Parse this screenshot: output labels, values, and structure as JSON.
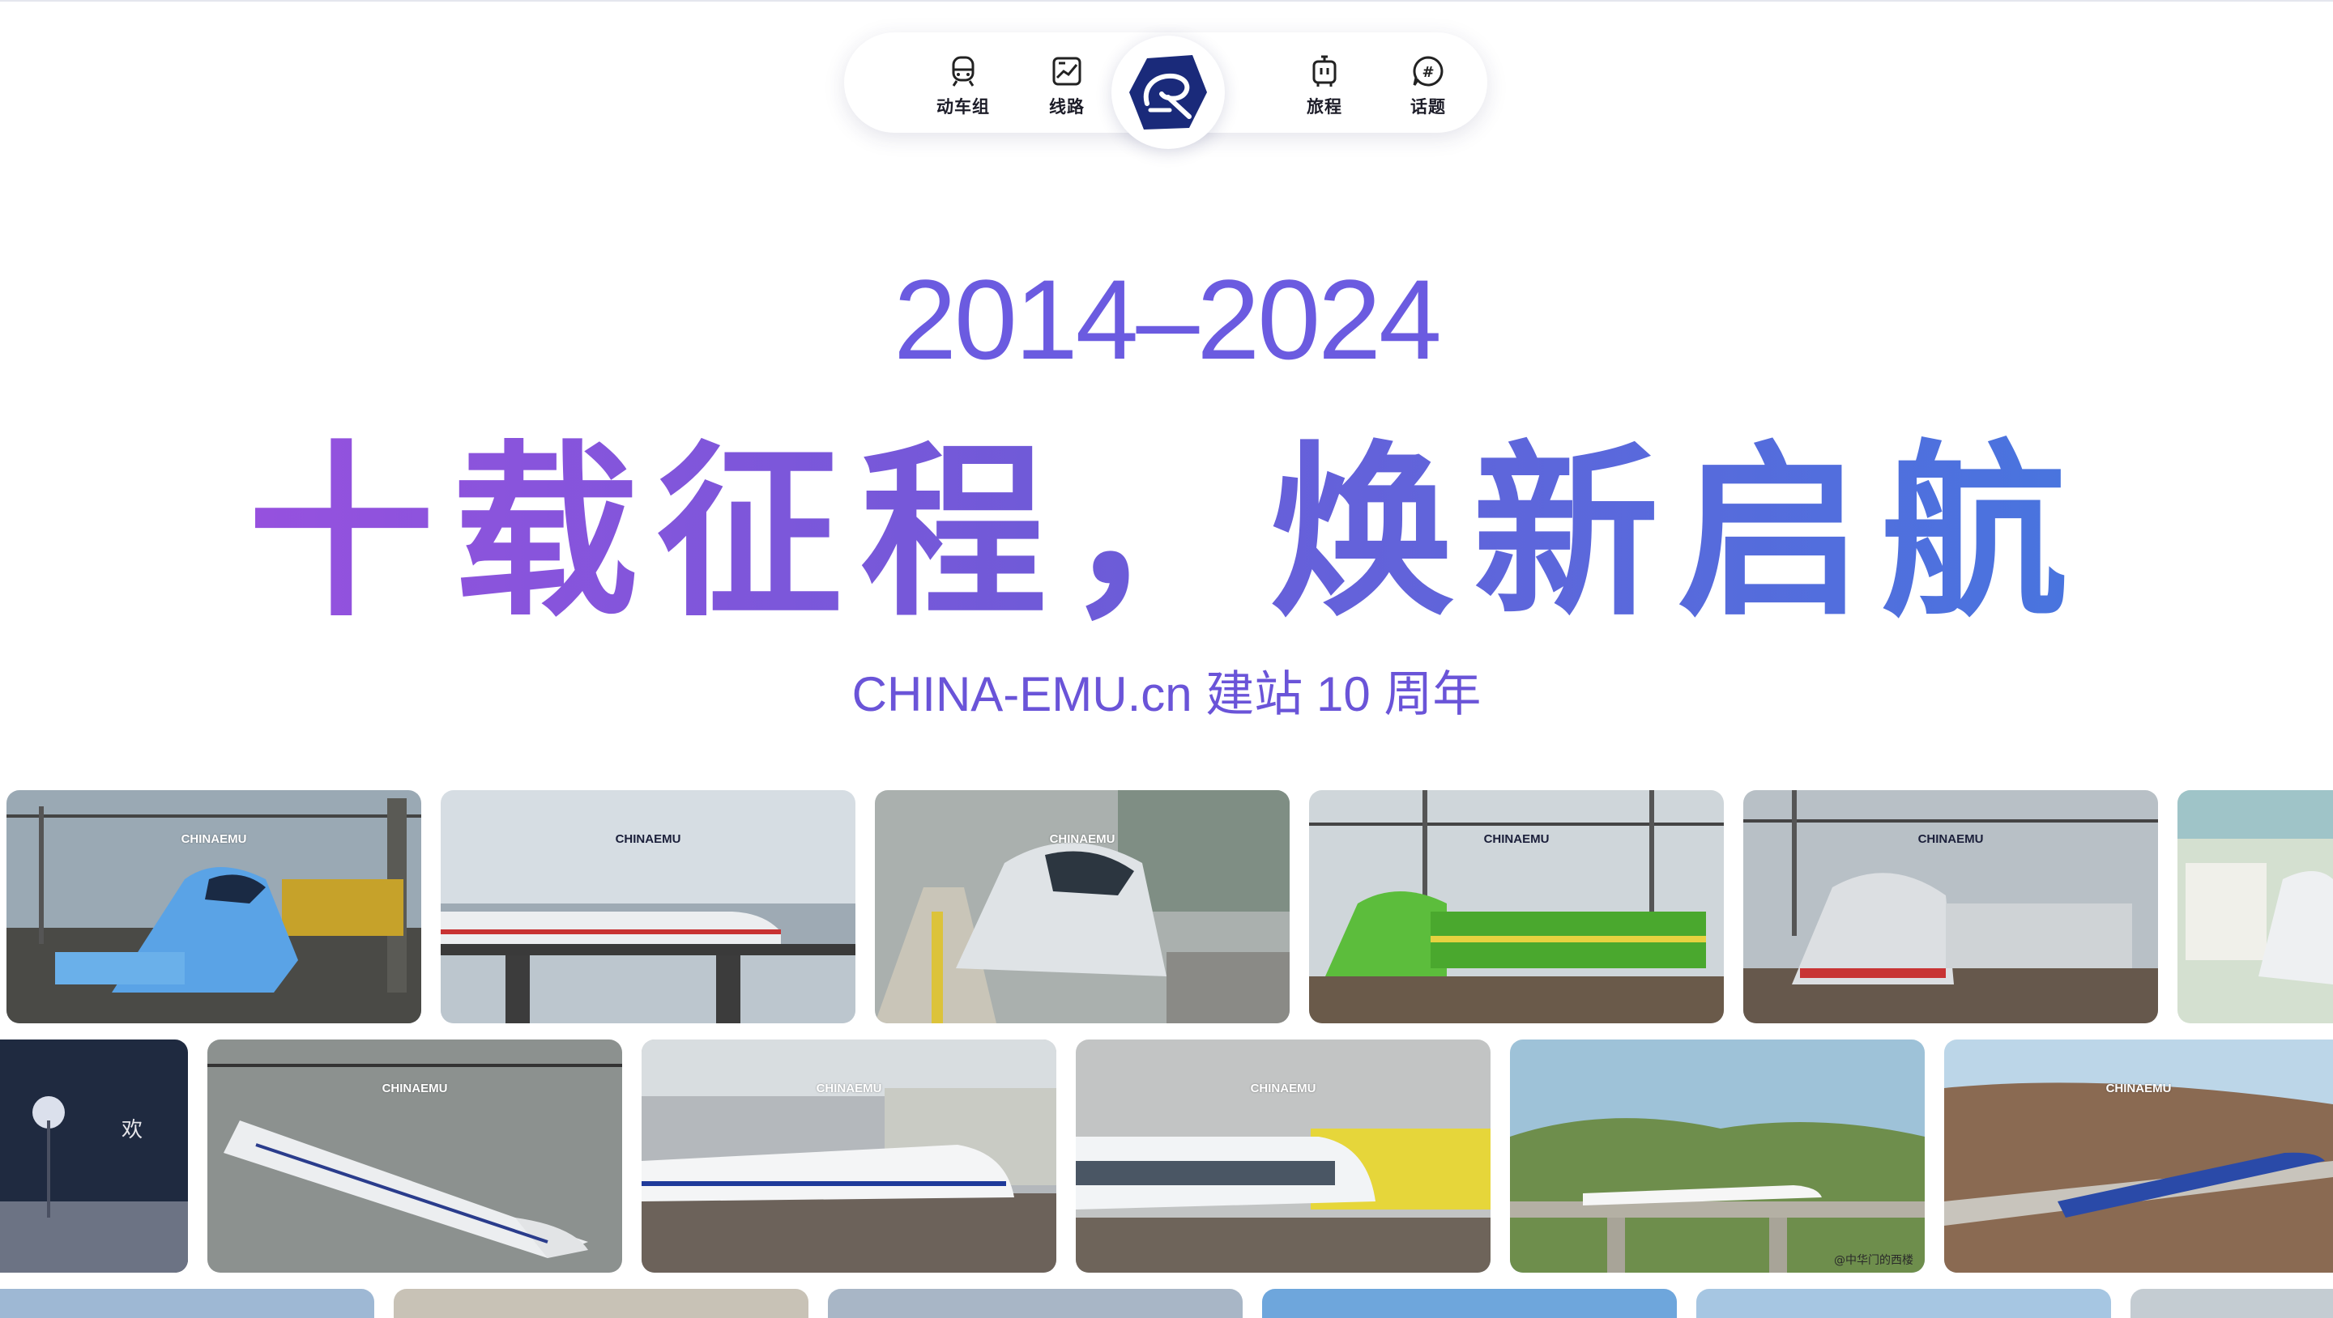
{
  "nav": {
    "items": [
      {
        "label": "动车组",
        "icon": "train-icon"
      },
      {
        "label": "线路",
        "icon": "route-icon"
      },
      {
        "label": "旅程",
        "icon": "luggage-icon"
      },
      {
        "label": "话题",
        "icon": "topic-icon"
      }
    ],
    "logo": "china-emu-logo"
  },
  "hero": {
    "years": "2014–2024",
    "title": "十载征程，焕新启航",
    "subtitle": "CHINA-EMU.cn 建站 10 周年"
  },
  "gallery": {
    "watermark": "CHINAEMU",
    "credit": "@中华门的西楼"
  },
  "colors": {
    "accent_purple": "#6b5be0",
    "gradient_start": "#a24ee0",
    "gradient_end": "#3f7be0",
    "logo_navy": "#1a2a7a"
  }
}
